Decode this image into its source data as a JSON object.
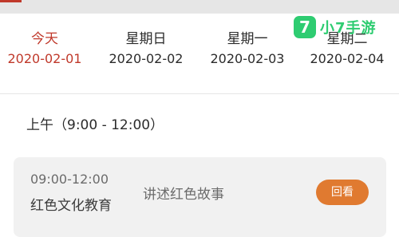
{
  "watermark": {
    "icon_glyph": "7",
    "text": "小7手游",
    "color": "#2ecc71"
  },
  "dates": [
    {
      "name": "今天",
      "date": "2020-02-01",
      "active": true
    },
    {
      "name": "星期日",
      "date": "2020-02-02",
      "active": false
    },
    {
      "name": "星期一",
      "date": "2020-02-03",
      "active": false
    },
    {
      "name": "星期二",
      "date": "2020-02-04",
      "active": false
    }
  ],
  "section": {
    "title": "上午（9:00 - 12:00）"
  },
  "program": {
    "time": "09:00-12:00",
    "title": "红色文化教育",
    "description": "讲述红色故事",
    "button_label": "回看"
  },
  "colors": {
    "active": "#c0392b",
    "button": "#e07a30",
    "card": "#f1f1f1"
  }
}
